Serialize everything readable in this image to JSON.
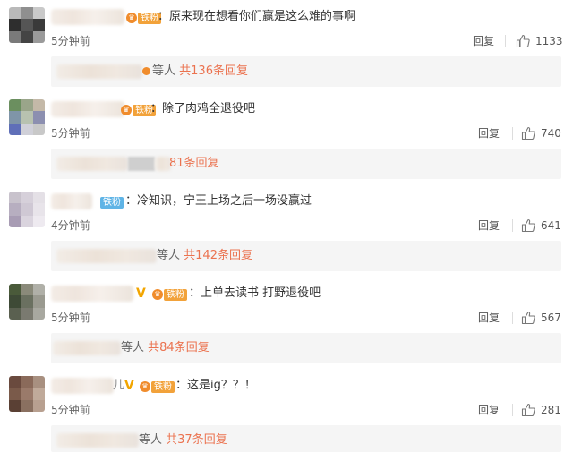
{
  "colors": {
    "link": "#eb7350",
    "badge_gold": "#f2a23a",
    "badge_blue": "#5fb4e6",
    "vip_v": "#f2a500"
  },
  "comments": [
    {
      "content": "：原来现在想看你们赢是这么难的事啊",
      "badge": "铁粉",
      "time": "5分钟前",
      "reply_label": "回复",
      "like_count": "1133",
      "subreply": {
        "suffix": "等人",
        "count_text": "共136条回复"
      }
    },
    {
      "content": "：除了肉鸡全退役吧",
      "badge": "铁粉",
      "time": "5分钟前",
      "reply_label": "回复",
      "like_count": "740",
      "subreply": {
        "suffix": "",
        "count_text": "81条回复"
      }
    },
    {
      "content": "：冷知识，宁王上场之后一场没赢过",
      "badge": "铁粉",
      "time": "4分钟前",
      "reply_label": "回复",
      "like_count": "641",
      "subreply": {
        "suffix": "等人",
        "count_text": "共142条回复"
      }
    },
    {
      "content": "：上单去读书 打野退役吧",
      "badge": "铁粉",
      "time": "5分钟前",
      "reply_label": "回复",
      "like_count": "567",
      "subreply": {
        "suffix": "等人",
        "count_text": "共84条回复"
      }
    },
    {
      "content": "：这是ig？？！",
      "name_tail": "儿",
      "badge": "铁粉",
      "time": "5分钟前",
      "reply_label": "回复",
      "like_count": "281",
      "subreply": {
        "suffix": "等人",
        "count_text": "共37条回复"
      }
    }
  ]
}
